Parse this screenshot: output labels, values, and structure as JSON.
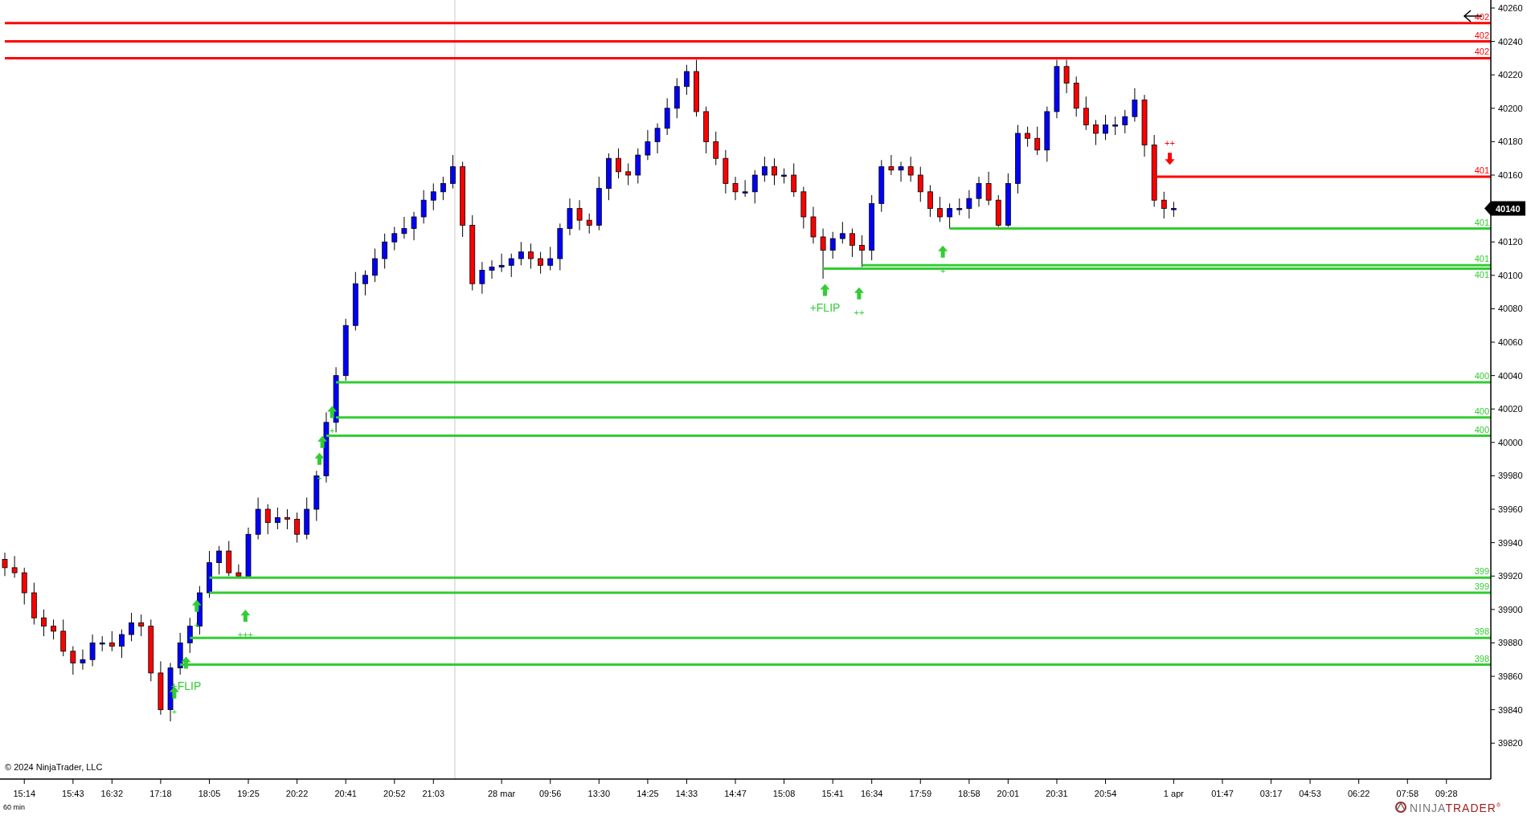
{
  "chart": {
    "chart_data": {
      "type": "candlestick",
      "ylim": [
        39798.5,
        40264.8
      ],
      "yticks": [
        40260,
        40240,
        40220,
        40200,
        40180,
        40160,
        40140,
        40120,
        40100,
        40080,
        40060,
        40040,
        40020,
        40000,
        39980,
        39960,
        39940,
        39920,
        39900,
        39880,
        39860,
        39840,
        39820
      ],
      "categories": [
        null,
        null,
        "15:14",
        null,
        null,
        null,
        null,
        "15:43",
        null,
        null,
        null,
        "16:32",
        null,
        null,
        null,
        null,
        "17:18",
        null,
        null,
        null,
        null,
        "18:05",
        null,
        null,
        null,
        "19:25",
        null,
        null,
        null,
        null,
        "20:22",
        null,
        null,
        null,
        null,
        "20:41",
        null,
        null,
        null,
        null,
        "20:52",
        null,
        null,
        null,
        "21:03",
        null,
        null,
        null,
        null,
        null,
        null,
        "28 mar",
        null,
        null,
        null,
        null,
        "09:56",
        null,
        null,
        null,
        null,
        "13:30",
        null,
        null,
        null,
        null,
        "14:25",
        null,
        null,
        null,
        "14:33",
        null,
        null,
        null,
        null,
        "14:47",
        null,
        null,
        null,
        null,
        "15:08",
        null,
        null,
        null,
        null,
        "15:41",
        null,
        null,
        null,
        "16:34",
        null,
        null,
        null,
        null,
        "17:59",
        null,
        null,
        null,
        null,
        "18:58",
        null,
        null,
        null,
        "20:01",
        null,
        null,
        null,
        null,
        "20:31",
        null,
        null,
        null,
        null,
        "20:54",
        null,
        null,
        null,
        null,
        null,
        null,
        "1 apr",
        null,
        null,
        null,
        null,
        "01:47",
        null,
        null,
        null,
        null,
        "03:17",
        null,
        null,
        null,
        "04:53",
        null,
        null,
        null,
        null,
        "06:22",
        null,
        null,
        null,
        null,
        "07:58",
        null,
        null,
        null,
        "09:28",
        null,
        null
      ],
      "ohlc": [
        [
          39930,
          39934,
          39920,
          39925
        ],
        [
          39925,
          39932,
          39919,
          39922
        ],
        [
          39922,
          39925,
          39903,
          39910
        ],
        [
          39910,
          39916,
          39891,
          39895
        ],
        [
          39895,
          39900,
          39884,
          39890
        ],
        [
          39890,
          39894,
          39882,
          39887
        ],
        [
          39887,
          39894,
          39872,
          39875
        ],
        [
          39875,
          39878,
          39861,
          39868
        ],
        [
          39868,
          39876,
          39864,
          39870
        ],
        [
          39870,
          39885,
          39866,
          39880
        ],
        [
          39880,
          39884,
          39875,
          39880
        ],
        [
          39880,
          39887,
          39875,
          39878
        ],
        [
          39878,
          39888,
          39871,
          39885
        ],
        [
          39885,
          39898,
          39881,
          39892
        ],
        [
          39892,
          39897,
          39884,
          39890
        ],
        [
          39890,
          39894,
          39857,
          39862
        ],
        [
          39862,
          39869,
          39837,
          39840
        ],
        [
          39840,
          39868,
          39833,
          39865
        ],
        [
          39865,
          39886,
          39861,
          39880
        ],
        [
          39880,
          39895,
          39874,
          39890
        ],
        [
          39890,
          39914,
          39885,
          39910
        ],
        [
          39910,
          39935,
          39907,
          39928
        ],
        [
          39928,
          39938,
          39921,
          39935
        ],
        [
          39935,
          39941,
          39920,
          39922
        ],
        [
          39922,
          39927,
          39920,
          39920
        ],
        [
          39920,
          39949,
          39920,
          39945
        ],
        [
          39945,
          39967,
          39942,
          39960
        ],
        [
          39960,
          39963,
          39945,
          39952
        ],
        [
          39952,
          39961,
          39948,
          39955
        ],
        [
          39955,
          39960,
          39948,
          39954
        ],
        [
          39954,
          39958,
          39940,
          39945
        ],
        [
          39945,
          39967,
          39942,
          39960
        ],
        [
          39960,
          39983,
          39953,
          39980
        ],
        [
          39980,
          40018,
          39976,
          40012
        ],
        [
          40012,
          40045,
          40006,
          40040
        ],
        [
          40040,
          40074,
          40037,
          40070
        ],
        [
          40070,
          40102,
          40067,
          40095
        ],
        [
          40095,
          40103,
          40088,
          40100
        ],
        [
          40100,
          40116,
          40096,
          40110
        ],
        [
          40110,
          40125,
          40104,
          40120
        ],
        [
          40120,
          40129,
          40115,
          40125
        ],
        [
          40125,
          40135,
          40122,
          40128
        ],
        [
          40128,
          40138,
          40121,
          40135
        ],
        [
          40135,
          40151,
          40131,
          40145
        ],
        [
          40145,
          40155,
          40139,
          40150
        ],
        [
          40150,
          40159,
          40145,
          40155
        ],
        [
          40155,
          40172,
          40152,
          40165
        ],
        [
          40165,
          40168,
          40123,
          40130
        ],
        [
          40130,
          40136,
          40091,
          40095
        ],
        [
          40095,
          40108,
          40089,
          40103
        ],
        [
          40103,
          40109,
          40098,
          40105
        ],
        [
          40105,
          40113,
          40102,
          40106
        ],
        [
          40106,
          40113,
          40099,
          40110
        ],
        [
          40110,
          40120,
          40106,
          40114
        ],
        [
          40114,
          40119,
          40104,
          40110
        ],
        [
          40110,
          40114,
          40101,
          40106
        ],
        [
          40106,
          40117,
          40103,
          40110
        ],
        [
          40110,
          40131,
          40103,
          40128
        ],
        [
          40128,
          40146,
          40124,
          40140
        ],
        [
          40140,
          40145,
          40127,
          40133
        ],
        [
          40133,
          40137,
          40125,
          40130
        ],
        [
          40130,
          40159,
          40127,
          40152
        ],
        [
          40152,
          40173,
          40145,
          40170
        ],
        [
          40170,
          40176,
          40158,
          40162
        ],
        [
          40162,
          40167,
          40154,
          40160
        ],
        [
          40160,
          40176,
          40155,
          40172
        ],
        [
          40172,
          40187,
          40169,
          40180
        ],
        [
          40180,
          40191,
          40173,
          40188
        ],
        [
          40188,
          40206,
          40184,
          40200
        ],
        [
          40200,
          40218,
          40194,
          40213
        ],
        [
          40213,
          40226,
          40208,
          40222
        ],
        [
          40222,
          40229,
          40195,
          40198
        ],
        [
          40198,
          40201,
          40173,
          40180
        ],
        [
          40180,
          40186,
          40166,
          40170
        ],
        [
          40170,
          40175,
          40149,
          40155
        ],
        [
          40155,
          40159,
          40145,
          40150
        ],
        [
          40150,
          40157,
          40147,
          40150
        ],
        [
          40150,
          40163,
          40143,
          40160
        ],
        [
          40160,
          40171,
          40156,
          40165
        ],
        [
          40165,
          40170,
          40154,
          40160
        ],
        [
          40160,
          40164,
          40155,
          40160
        ],
        [
          40160,
          40167,
          40147,
          40150
        ],
        [
          40150,
          40153,
          40128,
          40135
        ],
        [
          40135,
          40141,
          40119,
          40123
        ],
        [
          40123,
          40128,
          40098,
          40115
        ],
        [
          40115,
          40126,
          40110,
          40122
        ],
        [
          40122,
          40132,
          40119,
          40125
        ],
        [
          40125,
          40128,
          40111,
          40118
        ],
        [
          40118,
          40124,
          40105,
          40115
        ],
        [
          40115,
          40148,
          40109,
          40143
        ],
        [
          40143,
          40169,
          40138,
          40165
        ],
        [
          40165,
          40172,
          40160,
          40163
        ],
        [
          40163,
          40168,
          40156,
          40165
        ],
        [
          40165,
          40171,
          40156,
          40160
        ],
        [
          40160,
          40165,
          40144,
          40150
        ],
        [
          40150,
          40154,
          40135,
          40140
        ],
        [
          40140,
          40147,
          40132,
          40135
        ],
        [
          40135,
          40143,
          40128,
          40140
        ],
        [
          40140,
          40146,
          40136,
          40140
        ],
        [
          40140,
          40151,
          40134,
          40146
        ],
        [
          40146,
          40159,
          40141,
          40155
        ],
        [
          40155,
          40162,
          40142,
          40145
        ],
        [
          40145,
          40148,
          40129,
          40130
        ],
        [
          40130,
          40161,
          40129,
          40155
        ],
        [
          40155,
          40190,
          40149,
          40185
        ],
        [
          40185,
          40189,
          40177,
          40182
        ],
        [
          40182,
          40189,
          40172,
          40175
        ],
        [
          40175,
          40201,
          40168,
          40198
        ],
        [
          40198,
          40229,
          40194,
          40225
        ],
        [
          40225,
          40229,
          40209,
          40215
        ],
        [
          40215,
          40219,
          40195,
          40200
        ],
        [
          40200,
          40207,
          40187,
          40190
        ],
        [
          40190,
          40193,
          40178,
          40185
        ],
        [
          40185,
          40196,
          40181,
          40190
        ],
        [
          40190,
          40195,
          40184,
          40190
        ],
        [
          40190,
          40199,
          40185,
          40195
        ],
        [
          40195,
          40212,
          40192,
          40205
        ],
        [
          40205,
          40208,
          40171,
          40178
        ],
        [
          40178,
          40184,
          40141,
          40145
        ],
        [
          40145,
          40150,
          40134,
          40140
        ],
        [
          40140,
          40144,
          40135,
          40140
        ],
        null,
        null,
        null,
        null,
        null,
        null,
        null,
        null,
        null,
        null,
        null,
        null,
        null,
        null,
        null,
        null,
        null,
        null,
        null,
        null,
        null,
        null,
        null,
        null,
        null,
        null,
        null,
        null,
        null,
        null
      ],
      "ref_lines": [
        {
          "axis": "y",
          "value": 40251,
          "color": "#ff0000"
        },
        {
          "axis": "y",
          "value": 40240,
          "color": "#ff0000"
        },
        {
          "axis": "y",
          "value": 40230,
          "color": "#ff0000"
        },
        {
          "axis": "y",
          "value": 40159,
          "color": "#ff0000"
        },
        {
          "axis": "y",
          "value": 40128,
          "color": "#33cc33"
        },
        {
          "axis": "y",
          "value": 40106,
          "color": "#33cc33"
        },
        {
          "axis": "y",
          "value": 40104,
          "color": "#33cc33"
        },
        {
          "axis": "y",
          "value": 40036,
          "color": "#33cc33"
        },
        {
          "axis": "y",
          "value": 40015,
          "color": "#33cc33"
        },
        {
          "axis": "y",
          "value": 40004,
          "color": "#33cc33"
        },
        {
          "axis": "y",
          "value": 39919,
          "color": "#33cc33"
        },
        {
          "axis": "y",
          "value": 39910,
          "color": "#33cc33"
        },
        {
          "axis": "y",
          "value": 39883,
          "color": "#33cc33"
        },
        {
          "axis": "y",
          "value": 39867,
          "color": "#33cc33"
        }
      ]
    }
  },
  "level_labels": [
    "402",
    "402",
    "402",
    "401",
    "401",
    "401",
    "401",
    "400",
    "400",
    "400",
    "399",
    "399",
    "398",
    "398"
  ],
  "signals": [
    {
      "kind": "up",
      "label": "+FLIP"
    },
    {
      "kind": "up",
      "label": "++"
    },
    {
      "kind": "up",
      "label": "+"
    },
    {
      "kind": "up",
      "label": "+"
    },
    {
      "kind": "up"
    },
    {
      "kind": "up",
      "label": "+"
    },
    {
      "kind": "up",
      "label": "+"
    },
    {
      "kind": "up",
      "label": "+++"
    },
    {
      "kind": "up",
      "label": "+FLIP"
    },
    {
      "kind": "up",
      "label": "+"
    },
    {
      "kind": "down",
      "label": "++"
    }
  ],
  "last_price": "40140",
  "copyright": "© 2024 NinjaTrader, LLC",
  "interval": "60 min",
  "logo": {
    "part_1": "NINJA",
    "part_2": "TRADER",
    "mark": "®"
  }
}
